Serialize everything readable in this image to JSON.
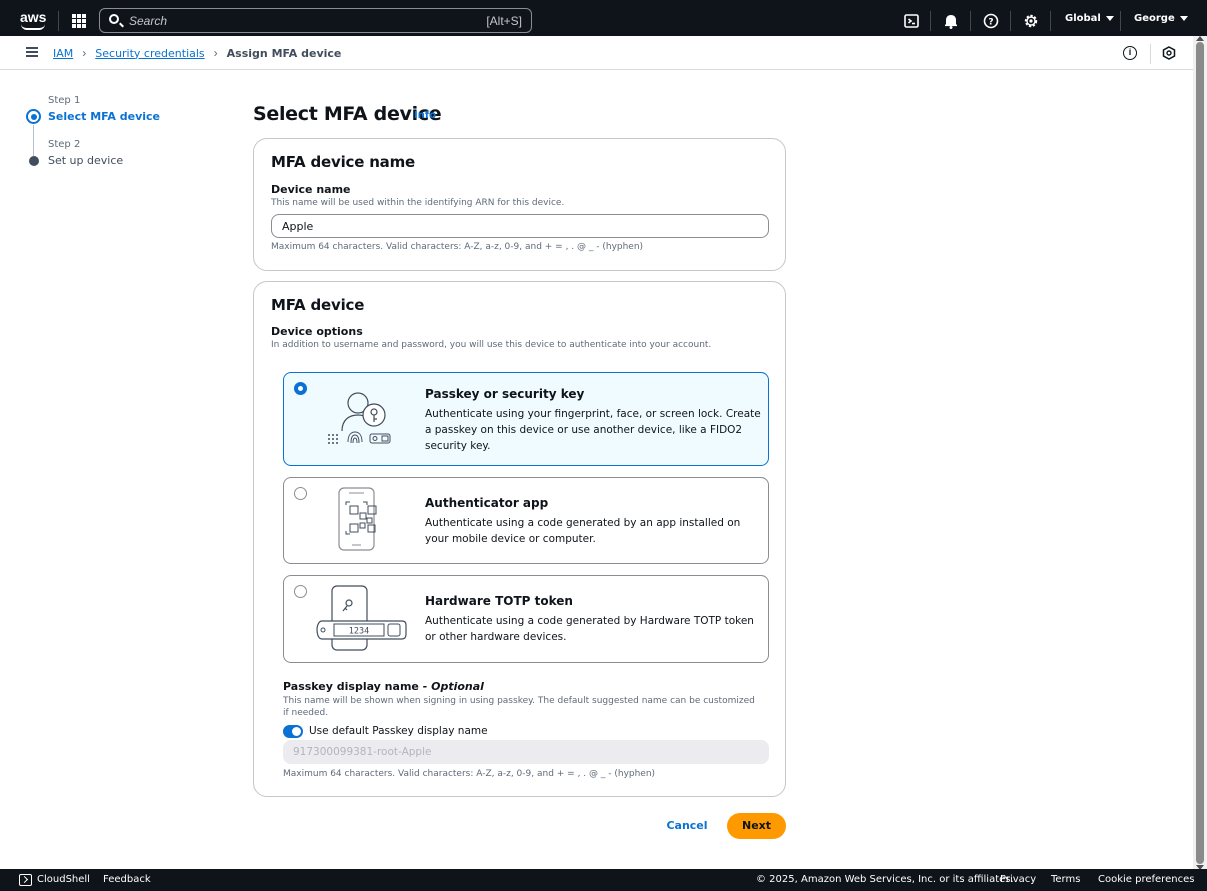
{
  "topnav": {
    "logo": "aws",
    "search_placeholder": "Search",
    "search_shortcut": "[Alt+S]",
    "region": "Global",
    "user": "George"
  },
  "breadcrumb": {
    "items": [
      "IAM",
      "Security credentials"
    ],
    "current": "Assign MFA device"
  },
  "steps": [
    {
      "label": "Step 1",
      "name": "Select MFA device",
      "active": true
    },
    {
      "label": "Step 2",
      "name": "Set up device",
      "active": false
    }
  ],
  "page": {
    "title": "Select MFA device",
    "info": "Info"
  },
  "name_card": {
    "heading": "MFA device name",
    "field_label": "Device name",
    "field_desc": "This name will be used within the identifying ARN for this device.",
    "value": "Apple",
    "constraint": "Maximum 64 characters. Valid characters: A-Z, a-z, 0-9, and + = , . @ _ - (hyphen)"
  },
  "device_card": {
    "heading": "MFA device",
    "options_label": "Device options",
    "options_desc": "In addition to username and password, you will use this device to authenticate into your account.",
    "options": [
      {
        "title": "Passkey or security key",
        "desc": "Authenticate using your fingerprint, face, or screen lock. Create a passkey on this device or use another device, like a FIDO2 security key.",
        "selected": true,
        "icon": "passkey-icon"
      },
      {
        "title": "Authenticator app",
        "desc": "Authenticate using a code generated by an app installed on your mobile device or computer.",
        "selected": false,
        "icon": "phone-qr-icon"
      },
      {
        "title": "Hardware TOTP token",
        "desc": "Authenticate using a code generated by Hardware TOTP token or other hardware devices.",
        "selected": false,
        "icon": "totp-token-icon"
      }
    ],
    "token_display": "1234",
    "passkey_label": "Passkey display name",
    "passkey_optional": "- Optional",
    "passkey_desc": "This name will be shown when signing in using passkey. The default suggested name can be customized if needed.",
    "toggle_label": "Use default Passkey display name",
    "toggle_on": true,
    "passkey_value": "917300099381-root-Apple",
    "passkey_constraint": "Maximum 64 characters. Valid characters: A-Z, a-z, 0-9, and + = , . @ _ - (hyphen)"
  },
  "actions": {
    "cancel": "Cancel",
    "next": "Next"
  },
  "footer": {
    "cloudshell": "CloudShell",
    "feedback": "Feedback",
    "copyright": "© 2025, Amazon Web Services, Inc. or its affiliates.",
    "privacy": "Privacy",
    "terms": "Terms",
    "cookies": "Cookie preferences"
  },
  "colors": {
    "accent": "#0972d3",
    "primary_button": "#ff9900",
    "nav_bg": "#0f141a"
  }
}
